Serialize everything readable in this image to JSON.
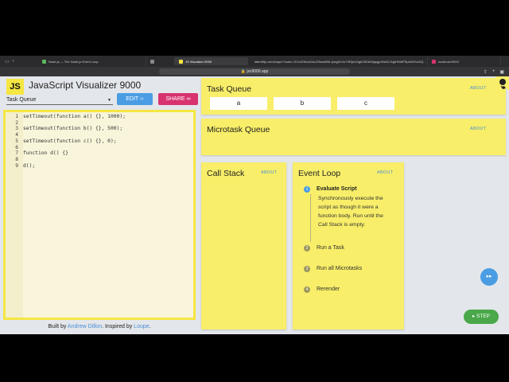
{
  "browser": {
    "tabs": [
      {
        "label": "Node.js — The Node.js Event Loop",
        "color": "#5cb85c"
      },
      {
        "label": "",
        "color": "#888888"
      },
      {
        "label": "JS Visualizer 9000",
        "color": "#f5e642"
      },
      {
        "label": "latentflip.com/loupe/?code=JGJvZHkub24oJ2NsaWNrJywgZnVuY3Rpb24gb25DbGljaygpIHsKICAgIHNldFRpbWVvdXQ...",
        "color": "#888888"
      },
      {
        "label": "localhost:9000",
        "color": "#d8336f"
      }
    ],
    "url": "jsv9000.app"
  },
  "app": {
    "logo": "JS",
    "title": "JavaScript Visualizer 9000",
    "preset": "Task Queue",
    "edit_label": "EDIT",
    "edit_icon": "‹›",
    "share_label": "SHARE",
    "share_icon": "∞"
  },
  "code": {
    "lines": [
      {
        "n": "1",
        "text": "setTimeout(function a() {}, 1000);"
      },
      {
        "n": "2",
        "text": ""
      },
      {
        "n": "3",
        "text": "setTimeout(function b() {}, 500);"
      },
      {
        "n": "4",
        "text": ""
      },
      {
        "n": "5",
        "text": "setTimeout(function c() {}, 0);"
      },
      {
        "n": "6",
        "text": ""
      },
      {
        "n": "7",
        "text": "function d() {}"
      },
      {
        "n": "8",
        "text": ""
      },
      {
        "n": "9",
        "text": "d();"
      }
    ]
  },
  "footer": {
    "prefix": "Built by ",
    "author": "Andrew Dillon",
    "middle": ". Inspired by ",
    "inspired": "Loupe",
    "suffix": "."
  },
  "task_queue": {
    "title": "Task Queue",
    "about": "ABOUT",
    "items": [
      "a",
      "b",
      "c"
    ]
  },
  "microtask_queue": {
    "title": "Microtask Queue",
    "about": "ABOUT"
  },
  "call_stack": {
    "title": "Call Stack",
    "about": "ABOUT"
  },
  "event_loop": {
    "title": "Event Loop",
    "about": "ABOUT",
    "steps": [
      {
        "num": "1",
        "label": "Evaluate Script",
        "active": true
      },
      {
        "num": "2",
        "label": "Run a Task",
        "active": false
      },
      {
        "num": "3",
        "label": "Run all Microtasks",
        "active": false
      },
      {
        "num": "4",
        "label": "Rerender",
        "active": false
      }
    ],
    "description": "Synchronously execute the script as though it were a function body. Run until the Call Stack is empty."
  },
  "controls": {
    "fast_forward": "▸▸",
    "step_label": "▸ STEP"
  },
  "colors": {
    "yellow": "#f8ee69",
    "blue": "#4a9de3",
    "pink": "#d8336f",
    "green": "#4aa84a"
  }
}
